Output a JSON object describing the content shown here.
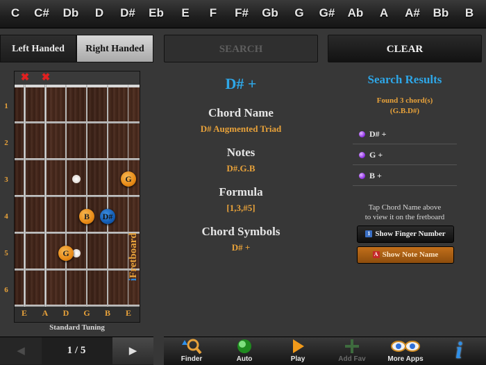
{
  "note_bar": {
    "notes": [
      "C",
      "C#",
      "Db",
      "D",
      "D#",
      "Eb",
      "E",
      "F",
      "F#",
      "Gb",
      "G",
      "G#",
      "Ab",
      "A",
      "A#",
      "Bb",
      "B"
    ]
  },
  "hand_toggle": {
    "left_label": "Left Handed",
    "right_label": "Right Handed",
    "selected": "Right Handed"
  },
  "search_button": {
    "label": "SEARCH",
    "enabled": false
  },
  "clear_button": {
    "label": "CLEAR"
  },
  "fretboard": {
    "fret_numbers": [
      "1",
      "2",
      "3",
      "4",
      "5",
      "6"
    ],
    "muted_strings": [
      "E",
      "A"
    ],
    "mute_symbol": "✖",
    "open_string_notes": [
      "E",
      "A",
      "D",
      "G",
      "B",
      "E"
    ],
    "fingered_notes": [
      {
        "string": 6,
        "fret": 3,
        "note": "G",
        "color": "orange"
      },
      {
        "string": 4,
        "fret": 4,
        "note": "B",
        "color": "orange"
      },
      {
        "string": 5,
        "fret": 4,
        "note": "D#",
        "color": "blue"
      },
      {
        "string": 3,
        "fret": 5,
        "note": "G",
        "color": "orange"
      }
    ],
    "logo_prefix": "i",
    "logo_text": "Fretboard",
    "tuning": "Standard Tuning"
  },
  "chord": {
    "title": "D# +",
    "name_label": "Chord Name",
    "name": "D# Augmented Triad",
    "notes_label": "Notes",
    "notes": "D#.G.B",
    "formula_label": "Formula",
    "formula": "[1,3,#5]",
    "symbols_label": "Chord Symbols",
    "symbols": "D# +"
  },
  "search_results": {
    "title": "Search Results",
    "found_line1": "Found 3 chord(s)",
    "found_line2": "(G.B.D#)",
    "items": [
      "D# +",
      "G +",
      "B +"
    ],
    "tap_hint_line1": "Tap Chord Name above",
    "tap_hint_line2": "to view it on the fretboard",
    "finger_button": {
      "icon_label": "1",
      "label": "Show Finger Number"
    },
    "notename_button": {
      "icon_label": "A",
      "label": "Show Note Name"
    }
  },
  "pager": {
    "prev_symbol": "◀",
    "indicator": "1 / 5",
    "next_symbol": "▶"
  },
  "toolbar": {
    "finder": "Finder",
    "auto": "Auto",
    "play": "Play",
    "add_fav": "Add Fav",
    "more_apps": "More Apps",
    "info_symbol": "i"
  },
  "colors": {
    "accent_orange": "#e8a23a",
    "accent_blue": "#2ea7e8",
    "mute_red": "#e02020",
    "background": "#373737"
  }
}
